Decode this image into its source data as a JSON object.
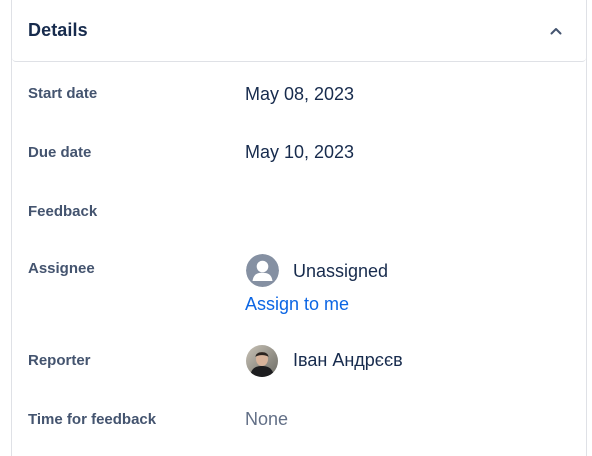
{
  "header": {
    "title": "Details"
  },
  "fields": {
    "start_date": {
      "label": "Start date",
      "value": "May 08, 2023"
    },
    "due_date": {
      "label": "Due date",
      "value": "May 10, 2023"
    },
    "feedback": {
      "label": "Feedback",
      "value": ""
    },
    "assignee": {
      "label": "Assignee",
      "value": "Unassigned",
      "action": "Assign to me"
    },
    "reporter": {
      "label": "Reporter",
      "value": "Іван Андрєєв"
    },
    "time_for_feedback": {
      "label": "Time for feedback",
      "value": "None"
    }
  },
  "colors": {
    "link": "#0c66e4",
    "label": "#44546f",
    "text": "#172b4d",
    "border": "#dfe1e6"
  },
  "icons": {
    "collapse": "chevron-up-icon",
    "unassigned_avatar": "person-icon"
  }
}
